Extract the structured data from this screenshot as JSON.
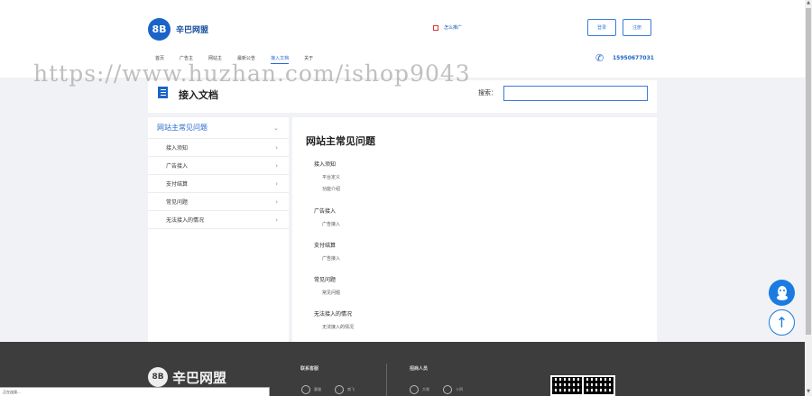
{
  "brand": {
    "logo_mark": "8B",
    "name": "辛巴网盟"
  },
  "header": {
    "promo_text": "怎么推广",
    "login_label": "登录",
    "register_label": "注册",
    "phone": "15950677031",
    "nav": [
      "首页",
      "广告主",
      "网站主",
      "最新公告",
      "接入文档",
      "关于"
    ]
  },
  "watermark": "https://www.huzhan.com/ishop9043",
  "doc": {
    "title": "接入文档",
    "search_label": "搜索："
  },
  "sidebar": {
    "header": "网站主常见问题",
    "items": [
      "接入须知",
      "广告接入",
      "支付结算",
      "常见问题",
      "无法接入的情况"
    ]
  },
  "main": {
    "title": "网站主常见问题",
    "sections": [
      {
        "title": "接入须知",
        "links": [
          "平台定义",
          "功能介绍"
        ]
      },
      {
        "title": "广告接入",
        "links": [
          "广告接入"
        ]
      },
      {
        "title": "支付结算",
        "links": [
          "广告接入"
        ]
      },
      {
        "title": "常见问题",
        "links": [
          "常见问题"
        ]
      },
      {
        "title": "无法接入的情况",
        "links": [
          "无法接入的情况"
        ]
      }
    ]
  },
  "footer": {
    "logo_mark": "8B",
    "logo_text": "辛巴网盟",
    "contact_title": "联系客服",
    "partner_title": "招商人员",
    "contacts": [
      "客服",
      "商飞"
    ],
    "partners": [
      "大咪",
      "十四"
    ]
  },
  "statusbar": {
    "text": "正在连接..."
  }
}
